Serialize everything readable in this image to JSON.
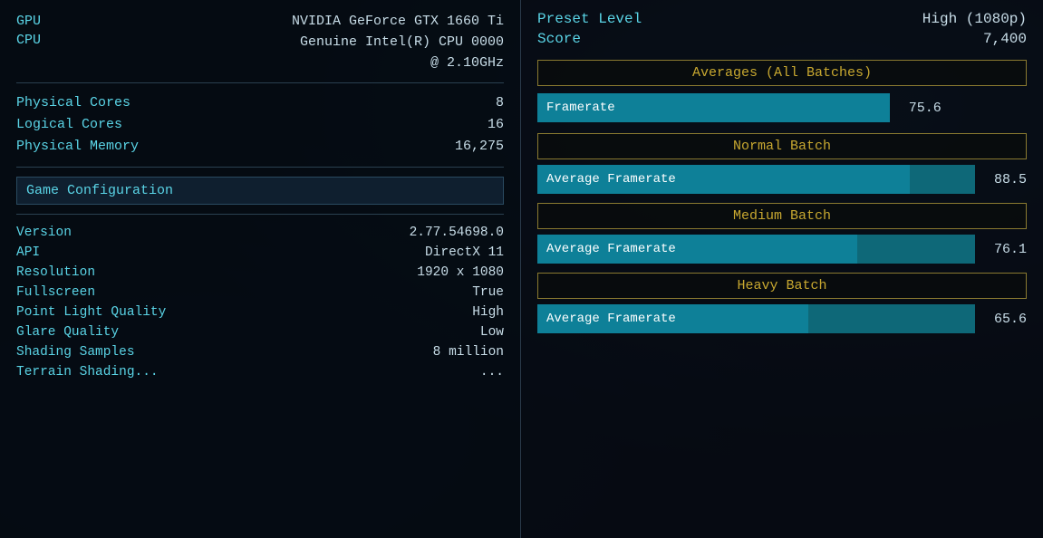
{
  "system": {
    "gpu_label": "GPU",
    "gpu_value": "NVIDIA GeForce GTX 1660 Ti",
    "cpu_label": "CPU",
    "cpu_value_line1": "Genuine Intel(R) CPU 0000",
    "cpu_value_line2": "@ 2.10GHz",
    "physical_cores_label": "Physical Cores",
    "physical_cores_value": "8",
    "logical_cores_label": "Logical Cores",
    "logical_cores_value": "16",
    "physical_memory_label": "Physical Memory",
    "physical_memory_value": "16,275"
  },
  "game_config": {
    "header": "Game Configuration",
    "version_label": "Version",
    "version_value": "2.77.54698.0",
    "api_label": "API",
    "api_value": "DirectX 11",
    "resolution_label": "Resolution",
    "resolution_value": "1920 x 1080",
    "fullscreen_label": "Fullscreen",
    "fullscreen_value": "True",
    "point_light_label": "Point Light Quality",
    "point_light_value": "High",
    "glare_label": "Glare Quality",
    "glare_value": "Low",
    "shading_label": "Shading Samples",
    "shading_value": "8 million",
    "terrain_label": "Terrain Shading...",
    "terrain_value": "..."
  },
  "results": {
    "preset_label": "Preset Level",
    "preset_value": "High (1080p)",
    "score_label": "Score",
    "score_value": "7,400",
    "averages_header": "Averages (All Batches)",
    "main_framerate_label": "Framerate",
    "main_framerate_value": "75.6",
    "main_bar_width_pct": 73,
    "normal_batch_header": "Normal Batch",
    "normal_framerate_label": "Average Framerate",
    "normal_framerate_value": "88.5",
    "normal_bar_width_pct": 85,
    "medium_batch_header": "Medium Batch",
    "medium_framerate_label": "Average Framerate",
    "medium_framerate_value": "76.1",
    "medium_bar_width_pct": 73,
    "heavy_batch_header": "Heavy Batch",
    "heavy_framerate_label": "Average Framerate",
    "heavy_framerate_value": "65.6",
    "heavy_bar_width_pct": 62
  }
}
